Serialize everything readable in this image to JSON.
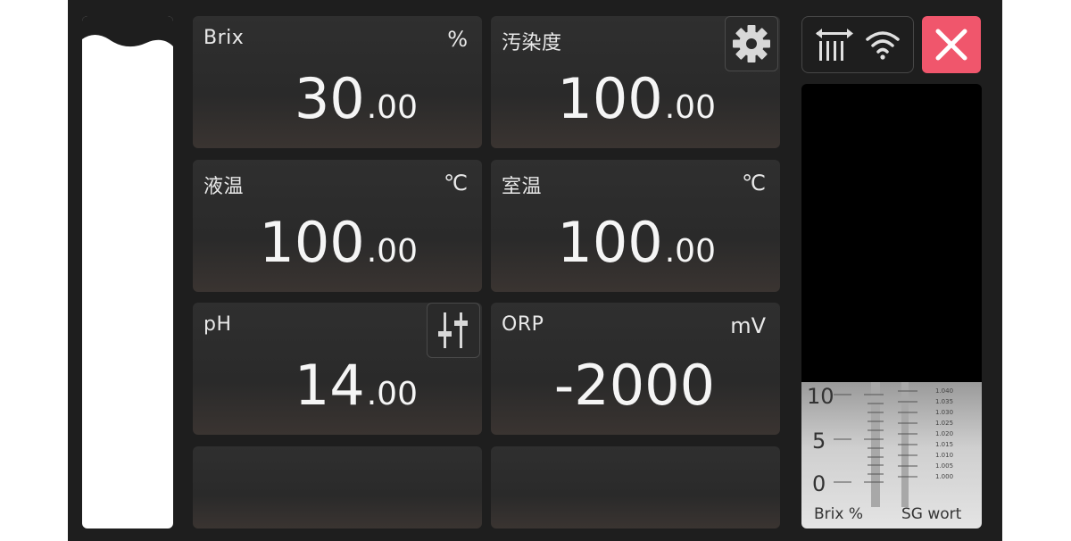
{
  "tiles": [
    {
      "label": "Brix",
      "unit": "%",
      "int": "30",
      "dec": ".00"
    },
    {
      "label": "汚染度",
      "unit": "",
      "int": "100",
      "dec": ".00"
    },
    {
      "label": "液温",
      "unit": "℃",
      "int": "100",
      "dec": ".00"
    },
    {
      "label": "室温",
      "unit": "℃",
      "int": "100",
      "dec": ".00"
    },
    {
      "label": "pH",
      "unit": "",
      "int": "14",
      "dec": ".00"
    },
    {
      "label": "ORP",
      "unit": "mV",
      "int": "-2000",
      "dec": ""
    }
  ],
  "icons": {
    "settings": "gear-icon",
    "adjust": "sliders-icon",
    "transfer": "transfer-icon",
    "wifi": "wifi-icon",
    "close": "close-icon"
  },
  "refractometer": {
    "brix_ticks": [
      "10",
      "5",
      "0"
    ],
    "sg_ticks": [
      "1.040",
      "1.035",
      "1.030",
      "1.025",
      "1.020",
      "1.015",
      "1.010",
      "1.005",
      "1.000"
    ],
    "left_caption": "Brix %",
    "right_caption": "SG wort"
  },
  "colors": {
    "background": "#1e1e1e",
    "tile": "#2e2e2e",
    "close": "#f0566c"
  }
}
